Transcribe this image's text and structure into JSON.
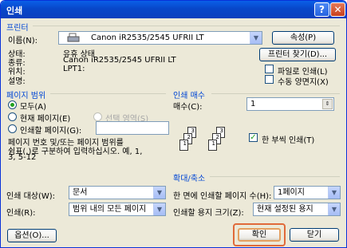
{
  "window": {
    "title": "인쇄",
    "help": "?",
    "close": "✕"
  },
  "printer": {
    "group_title": "프린터",
    "name_label": "이름(N):",
    "name_value": "Canon iR2535/2545 UFRII LT",
    "properties_btn": "속성(P)",
    "status_label": "상태:",
    "status_value": "유휴 상태",
    "type_label": "종류:",
    "type_value": "Canon iR2535/2545 UFRII LT",
    "where_label": "위치:",
    "where_value": "LPT1:",
    "comment_label": "설명:",
    "find_btn": "프린터 찾기(D)...",
    "print_to_file": "파일로 인쇄(L)",
    "manual_duplex": "수동 양면지(X)"
  },
  "page_range": {
    "group_title": "페이지 범위",
    "all": "모두(A)",
    "current": "현재 페이지(E)",
    "selection": "선택 영역(S)",
    "pages": "인쇄할 페이지(G):",
    "pages_value": "",
    "help_text": [
      "페이지 번호 및/또는 페이지 범위를",
      "쉼표(,)로 구분하여 입력하십시오. 예, 1,",
      "3, 5-12"
    ]
  },
  "copies": {
    "group_title": "인쇄 매수",
    "count_label": "매수(C):",
    "count_value": "1",
    "collate": "한 부씩 인쇄(T)",
    "page_digits": [
      "3",
      "2",
      "1",
      "3",
      "2",
      "1"
    ]
  },
  "zoom": {
    "group_title": "확대/축소",
    "pages_per_sheet_label": "한 면에 인쇄할 페이지 수(H):",
    "pages_per_sheet_value": "1페이지",
    "scale_label": "인쇄할 용지 크기(Z):",
    "scale_value": "현재 설정된 용지"
  },
  "print_what": {
    "label": "인쇄 대상(W):",
    "value": "문서",
    "print_label": "인쇄(R):",
    "print_value": "범위 내의 모든 페이지"
  },
  "buttons": {
    "options": "옵션(O)...",
    "ok": "확인",
    "close": "닫기"
  },
  "colors": {
    "accent": "#0046D5",
    "highlight": "#E06A3A",
    "titlebar": "#0A5FE8"
  }
}
